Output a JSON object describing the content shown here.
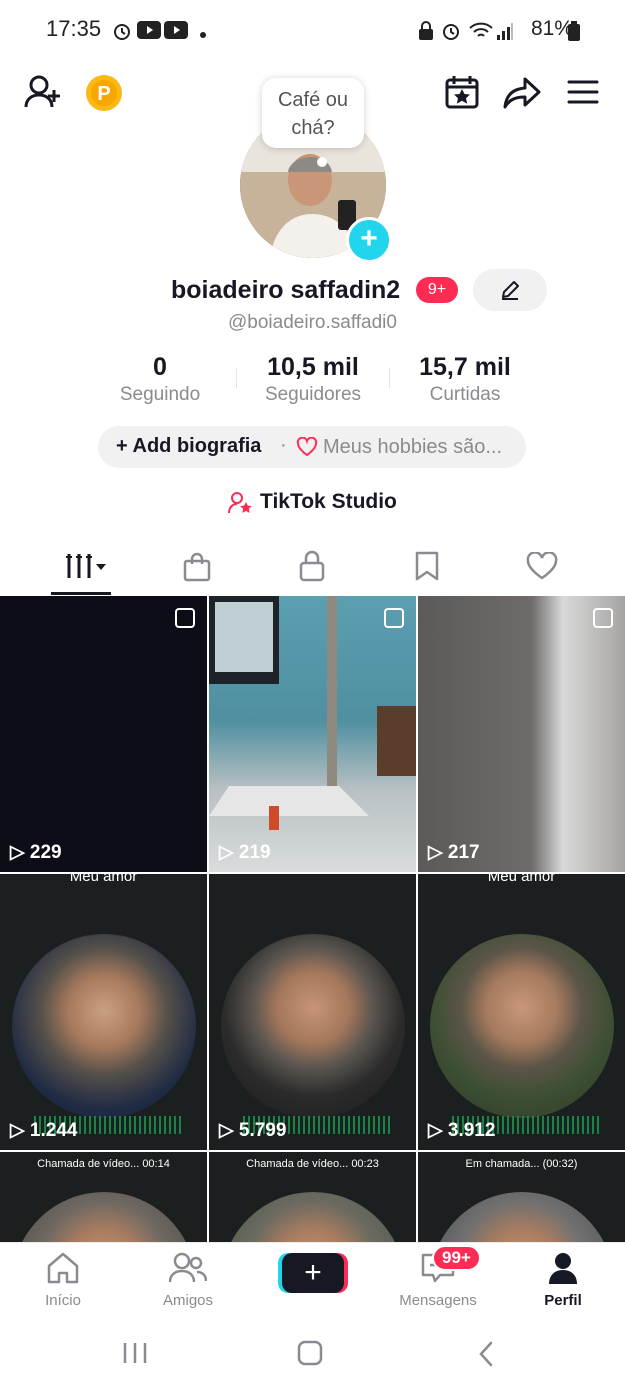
{
  "status_bar": {
    "time": "17:35",
    "battery": "81%"
  },
  "profile": {
    "bubble_text_1": "Café ou",
    "bubble_text_2": "chá?",
    "username": "boiadeiro saffadin2",
    "badge": "9+",
    "handle": "@boiadeiro.saffadi0"
  },
  "stats": [
    {
      "value": "0",
      "label": "Seguindo"
    },
    {
      "value": "10,5 mil",
      "label": "Seguidores"
    },
    {
      "value": "15,7 mil",
      "label": "Curtidas"
    }
  ],
  "bio": {
    "add_label": "Add biografia",
    "dot": "·",
    "hobbies": "Meus hobbies são..."
  },
  "studio": {
    "label": "TikTok Studio"
  },
  "tabs": [
    "videos-icon",
    "shop-icon",
    "lock-icon",
    "bookmark-icon",
    "heart-icon"
  ],
  "videos": [
    {
      "views": "229"
    },
    {
      "views": "219"
    },
    {
      "views": "217"
    },
    {
      "views": "1.244",
      "top_text": "Meu amor"
    },
    {
      "views": "5.799"
    },
    {
      "views": "3.912",
      "top_text": "Meu amor"
    },
    {
      "top_text": "Chamada de vídeo... 00:14"
    },
    {
      "top_text": "Chamada de vídeo... 00:23"
    },
    {
      "top_text": "Em chamada... (00:32)"
    }
  ],
  "nav": {
    "home": "Início",
    "friends": "Amigos",
    "messages": "Mensagens",
    "messages_badge": "99+",
    "profile": "Perfil",
    "create": "+"
  },
  "colors": {
    "accent": "#fe2c55",
    "cyan": "#20d5ec",
    "coin": "#fcb813"
  }
}
